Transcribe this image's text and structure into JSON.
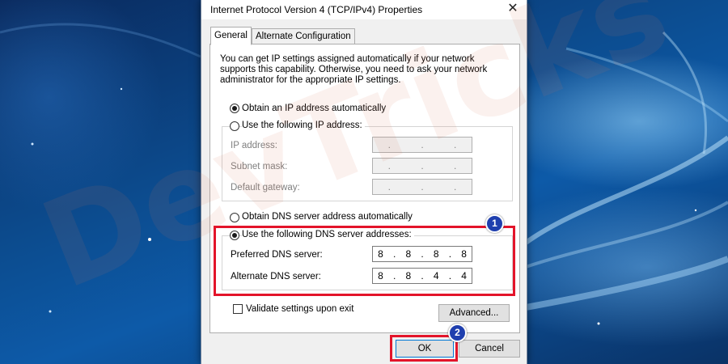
{
  "dialog": {
    "title": "Internet Protocol Version 4 (TCP/IPv4) Properties",
    "close_glyph": "✕"
  },
  "tabs": [
    {
      "label": "General",
      "active": true
    },
    {
      "label": "Alternate Configuration",
      "active": false
    }
  ],
  "description": "You can get IP settings assigned automatically if your network supports this capability. Otherwise, you need to ask your network administrator for the appropriate IP settings.",
  "ip": {
    "auto_label": "Obtain an IP address automatically",
    "auto_selected": true,
    "manual_label": "Use the following IP address:",
    "manual_selected": false,
    "fields": [
      {
        "label": "IP address:",
        "value": [
          "",
          "",
          "",
          ""
        ]
      },
      {
        "label": "Subnet mask:",
        "value": [
          "",
          "",
          "",
          ""
        ]
      },
      {
        "label": "Default gateway:",
        "value": [
          "",
          "",
          "",
          ""
        ]
      }
    ]
  },
  "dns": {
    "auto_label": "Obtain DNS server address automatically",
    "auto_selected": false,
    "manual_label": "Use the following DNS server addresses:",
    "manual_selected": true,
    "preferred": {
      "label": "Preferred DNS server:",
      "octets": [
        "8",
        "8",
        "8",
        "8"
      ]
    },
    "alternate": {
      "label": "Alternate DNS server:",
      "octets": [
        "8",
        "8",
        "4",
        "4"
      ]
    }
  },
  "validate": {
    "label": "Validate settings upon exit",
    "checked": false
  },
  "buttons": {
    "advanced": "Advanced...",
    "ok": "OK",
    "cancel": "Cancel"
  },
  "annotations": {
    "step1": "1",
    "step2": "2",
    "highlight_color": "#e3142a",
    "badge_color": "#1f3fae"
  },
  "watermark": "DevTricks"
}
